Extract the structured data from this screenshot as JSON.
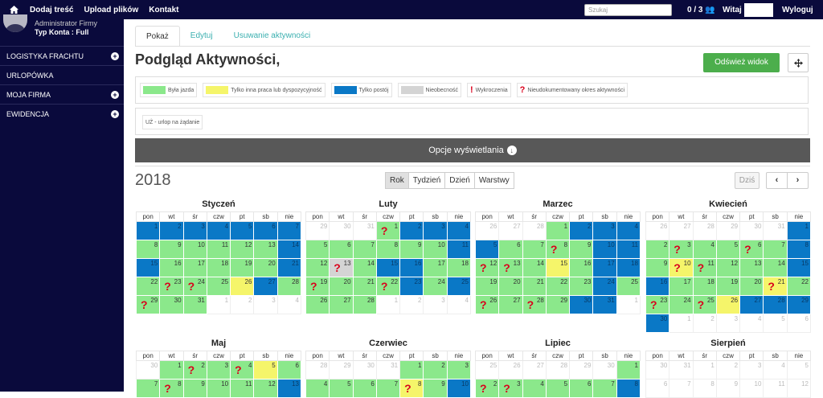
{
  "topbar": {
    "links": [
      "Dodaj treść",
      "Upload plików",
      "Kontakt"
    ],
    "search_placeholder": "Szukaj",
    "counter": "0 / 3",
    "greeting": "Witaj",
    "logout": "Wyloguj"
  },
  "sidebar": {
    "role": "Administrator Firmy",
    "account": "Typ Konta : Full",
    "items": [
      {
        "label": "LOGISTYKA FRACHTU",
        "expand": true
      },
      {
        "label": "URLOPÓWKA",
        "expand": false
      },
      {
        "label": "MOJA FIRMA",
        "expand": true
      },
      {
        "label": "EWIDENCJA",
        "expand": true
      }
    ]
  },
  "tabs": [
    "Pokaż",
    "Edytuj",
    "Usuwanie aktywności"
  ],
  "page_title": "Podgląd Aktywności,",
  "refresh_label": "Odśwież widok",
  "legend": [
    {
      "label": "Była jazda",
      "color": "#8be88b"
    },
    {
      "label": "Tylko inna praca lub dyspozycyjność",
      "color": "#f5f56a"
    },
    {
      "label": "Tylko postój",
      "color": "#0a78c6"
    },
    {
      "label": "Nieobecność",
      "color": "#d4d4d4"
    },
    {
      "label": "Wykroczenia",
      "icon": "!"
    },
    {
      "label": "Nieudokumentowany okres aktywności",
      "icon": "?"
    }
  ],
  "legend2": "UŻ - urlop na żądanie",
  "options_label": "Opcje wyświetlania",
  "year": "2018",
  "views": [
    "Rok",
    "Tydzień",
    "Dzień",
    "Warstwy"
  ],
  "today_label": "Dziś",
  "weekdays": [
    "pon",
    "wt",
    "śr",
    "czw",
    "pt",
    "sb",
    "nie"
  ],
  "months": [
    {
      "name": "Styczeń",
      "weeks": [
        [
          {
            "d": "1",
            "c": "b"
          },
          {
            "d": "2",
            "c": "b"
          },
          {
            "d": "3",
            "c": "b"
          },
          {
            "d": "4",
            "c": "b"
          },
          {
            "d": "5",
            "c": "b"
          },
          {
            "d": "6",
            "c": "b"
          },
          {
            "d": "7",
            "c": "b"
          }
        ],
        [
          {
            "d": "8",
            "c": "g"
          },
          {
            "d": "9",
            "c": "g"
          },
          {
            "d": "10",
            "c": "g"
          },
          {
            "d": "11",
            "c": "g"
          },
          {
            "d": "12",
            "c": "g"
          },
          {
            "d": "13",
            "c": "g"
          },
          {
            "d": "14",
            "c": "b"
          }
        ],
        [
          {
            "d": "15",
            "c": "b"
          },
          {
            "d": "16",
            "c": "g"
          },
          {
            "d": "17",
            "c": "g"
          },
          {
            "d": "18",
            "c": "g"
          },
          {
            "d": "19",
            "c": "g"
          },
          {
            "d": "20",
            "c": "g"
          },
          {
            "d": "21",
            "c": "b"
          }
        ],
        [
          {
            "d": "22",
            "c": "g"
          },
          {
            "d": "23",
            "c": "g",
            "q": "?"
          },
          {
            "d": "24",
            "c": "g",
            "q": "?"
          },
          {
            "d": "25",
            "c": "g"
          },
          {
            "d": "26",
            "c": "y"
          },
          {
            "d": "27",
            "c": "b"
          },
          {
            "d": "28",
            "c": "g"
          }
        ],
        [
          {
            "d": "29",
            "c": "g",
            "q": "?"
          },
          {
            "d": "30",
            "c": "g"
          },
          {
            "d": "31",
            "c": "g"
          },
          {
            "d": "1",
            "c": "o"
          },
          {
            "d": "2",
            "c": "o"
          },
          {
            "d": "3",
            "c": "o"
          },
          {
            "d": "4",
            "c": "o"
          }
        ]
      ]
    },
    {
      "name": "Luty",
      "weeks": [
        [
          {
            "d": "29",
            "c": "o"
          },
          {
            "d": "30",
            "c": "o"
          },
          {
            "d": "31",
            "c": "o"
          },
          {
            "d": "1",
            "c": "g",
            "q": "?"
          },
          {
            "d": "2",
            "c": "b"
          },
          {
            "d": "3",
            "c": "b"
          },
          {
            "d": "4",
            "c": "b"
          }
        ],
        [
          {
            "d": "5",
            "c": "g"
          },
          {
            "d": "6",
            "c": "g"
          },
          {
            "d": "7",
            "c": "g"
          },
          {
            "d": "8",
            "c": "g"
          },
          {
            "d": "9",
            "c": "g"
          },
          {
            "d": "10",
            "c": "g"
          },
          {
            "d": "11",
            "c": "b"
          }
        ],
        [
          {
            "d": "12",
            "c": "g"
          },
          {
            "d": "13",
            "c": "s",
            "q": "?"
          },
          {
            "d": "14",
            "c": "g"
          },
          {
            "d": "15",
            "c": "b"
          },
          {
            "d": "16",
            "c": "b"
          },
          {
            "d": "17",
            "c": "g"
          },
          {
            "d": "18",
            "c": "g"
          }
        ],
        [
          {
            "d": "19",
            "c": "g",
            "q": "?"
          },
          {
            "d": "20",
            "c": "g"
          },
          {
            "d": "21",
            "c": "g"
          },
          {
            "d": "22",
            "c": "g",
            "q": "?"
          },
          {
            "d": "23",
            "c": "b"
          },
          {
            "d": "24",
            "c": "g"
          },
          {
            "d": "25",
            "c": "b"
          }
        ],
        [
          {
            "d": "26",
            "c": "g"
          },
          {
            "d": "27",
            "c": "g"
          },
          {
            "d": "28",
            "c": "g"
          },
          {
            "d": "1",
            "c": "o"
          },
          {
            "d": "2",
            "c": "o"
          },
          {
            "d": "3",
            "c": "o"
          },
          {
            "d": "4",
            "c": "o"
          }
        ]
      ]
    },
    {
      "name": "Marzec",
      "weeks": [
        [
          {
            "d": "26",
            "c": "o"
          },
          {
            "d": "27",
            "c": "o"
          },
          {
            "d": "28",
            "c": "o"
          },
          {
            "d": "1",
            "c": "g"
          },
          {
            "d": "2",
            "c": "b"
          },
          {
            "d": "3",
            "c": "b"
          },
          {
            "d": "4",
            "c": "b"
          }
        ],
        [
          {
            "d": "5",
            "c": "b"
          },
          {
            "d": "6",
            "c": "g"
          },
          {
            "d": "7",
            "c": "g"
          },
          {
            "d": "8",
            "c": "g",
            "q": "?"
          },
          {
            "d": "9",
            "c": "g"
          },
          {
            "d": "10",
            "c": "b"
          },
          {
            "d": "11",
            "c": "b"
          }
        ],
        [
          {
            "d": "12",
            "c": "g",
            "q": "?"
          },
          {
            "d": "13",
            "c": "g",
            "q": "?"
          },
          {
            "d": "14",
            "c": "g"
          },
          {
            "d": "15",
            "c": "y"
          },
          {
            "d": "16",
            "c": "g"
          },
          {
            "d": "17",
            "c": "b"
          },
          {
            "d": "18",
            "c": "b"
          }
        ],
        [
          {
            "d": "19",
            "c": "g"
          },
          {
            "d": "20",
            "c": "g"
          },
          {
            "d": "21",
            "c": "g"
          },
          {
            "d": "22",
            "c": "g"
          },
          {
            "d": "23",
            "c": "g"
          },
          {
            "d": "24",
            "c": "b"
          },
          {
            "d": "25",
            "c": "g"
          }
        ],
        [
          {
            "d": "26",
            "c": "g",
            "q": "?"
          },
          {
            "d": "27",
            "c": "g"
          },
          {
            "d": "28",
            "c": "g",
            "q": "?"
          },
          {
            "d": "29",
            "c": "g"
          },
          {
            "d": "30",
            "c": "b"
          },
          {
            "d": "31",
            "c": "b"
          },
          {
            "d": "1",
            "c": "o"
          }
        ]
      ]
    },
    {
      "name": "Kwiecień",
      "weeks": [
        [
          {
            "d": "26",
            "c": "o"
          },
          {
            "d": "27",
            "c": "o"
          },
          {
            "d": "28",
            "c": "o"
          },
          {
            "d": "29",
            "c": "o"
          },
          {
            "d": "30",
            "c": "o"
          },
          {
            "d": "31",
            "c": "o"
          },
          {
            "d": "1",
            "c": "b"
          }
        ],
        [
          {
            "d": "2",
            "c": "g"
          },
          {
            "d": "3",
            "c": "g",
            "q": "?"
          },
          {
            "d": "4",
            "c": "g"
          },
          {
            "d": "5",
            "c": "g"
          },
          {
            "d": "6",
            "c": "g",
            "q": "?"
          },
          {
            "d": "7",
            "c": "g"
          },
          {
            "d": "8",
            "c": "b"
          }
        ],
        [
          {
            "d": "9",
            "c": "g"
          },
          {
            "d": "10",
            "c": "y",
            "q": "?"
          },
          {
            "d": "11",
            "c": "g",
            "q": "?"
          },
          {
            "d": "12",
            "c": "g"
          },
          {
            "d": "13",
            "c": "g"
          },
          {
            "d": "14",
            "c": "g"
          },
          {
            "d": "15",
            "c": "b"
          }
        ],
        [
          {
            "d": "16",
            "c": "b"
          },
          {
            "d": "17",
            "c": "g"
          },
          {
            "d": "18",
            "c": "g"
          },
          {
            "d": "19",
            "c": "g"
          },
          {
            "d": "20",
            "c": "g"
          },
          {
            "d": "21",
            "c": "y",
            "q": "?"
          },
          {
            "d": "22",
            "c": "g"
          }
        ],
        [
          {
            "d": "23",
            "c": "g",
            "q": "?"
          },
          {
            "d": "24",
            "c": "g"
          },
          {
            "d": "25",
            "c": "g",
            "q": "?"
          },
          {
            "d": "26",
            "c": "y"
          },
          {
            "d": "27",
            "c": "b"
          },
          {
            "d": "28",
            "c": "b"
          },
          {
            "d": "29",
            "c": "b"
          }
        ],
        [
          {
            "d": "30",
            "c": "b"
          },
          {
            "d": "1",
            "c": "o"
          },
          {
            "d": "2",
            "c": "o"
          },
          {
            "d": "3",
            "c": "o"
          },
          {
            "d": "4",
            "c": "o"
          },
          {
            "d": "5",
            "c": "o"
          },
          {
            "d": "6",
            "c": "o"
          }
        ]
      ]
    },
    {
      "name": "Maj",
      "weeks": [
        [
          {
            "d": "30",
            "c": "o"
          },
          {
            "d": "1",
            "c": "g"
          },
          {
            "d": "2",
            "c": "g",
            "q": "?"
          },
          {
            "d": "3",
            "c": "g"
          },
          {
            "d": "4",
            "c": "g",
            "q": "?"
          },
          {
            "d": "5",
            "c": "y"
          },
          {
            "d": "6",
            "c": "g"
          }
        ],
        [
          {
            "d": "7",
            "c": "g"
          },
          {
            "d": "8",
            "c": "g",
            "q": "?"
          },
          {
            "d": "9",
            "c": "g"
          },
          {
            "d": "10",
            "c": "g"
          },
          {
            "d": "11",
            "c": "g"
          },
          {
            "d": "12",
            "c": "g"
          },
          {
            "d": "13",
            "c": "b"
          }
        ]
      ]
    },
    {
      "name": "Czerwiec",
      "weeks": [
        [
          {
            "d": "28",
            "c": "o"
          },
          {
            "d": "29",
            "c": "o"
          },
          {
            "d": "30",
            "c": "o"
          },
          {
            "d": "31",
            "c": "o"
          },
          {
            "d": "1",
            "c": "g"
          },
          {
            "d": "2",
            "c": "g"
          },
          {
            "d": "3",
            "c": "g"
          }
        ],
        [
          {
            "d": "4",
            "c": "g"
          },
          {
            "d": "5",
            "c": "g"
          },
          {
            "d": "6",
            "c": "g"
          },
          {
            "d": "7",
            "c": "g"
          },
          {
            "d": "8",
            "c": "y",
            "q": "?"
          },
          {
            "d": "9",
            "c": "g"
          },
          {
            "d": "10",
            "c": "b"
          }
        ]
      ]
    },
    {
      "name": "Lipiec",
      "weeks": [
        [
          {
            "d": "25",
            "c": "o"
          },
          {
            "d": "26",
            "c": "o"
          },
          {
            "d": "27",
            "c": "o"
          },
          {
            "d": "28",
            "c": "o"
          },
          {
            "d": "29",
            "c": "o"
          },
          {
            "d": "30",
            "c": "o"
          },
          {
            "d": "1",
            "c": "g"
          }
        ],
        [
          {
            "d": "2",
            "c": "g",
            "q": "?"
          },
          {
            "d": "3",
            "c": "g",
            "q": "?"
          },
          {
            "d": "4",
            "c": "g"
          },
          {
            "d": "5",
            "c": "g"
          },
          {
            "d": "6",
            "c": "g"
          },
          {
            "d": "7",
            "c": "g"
          },
          {
            "d": "8",
            "c": "b"
          }
        ]
      ]
    },
    {
      "name": "Sierpień",
      "weeks": [
        [
          {
            "d": "30",
            "c": "o"
          },
          {
            "d": "31",
            "c": "o"
          },
          {
            "d": "1",
            "c": "o"
          },
          {
            "d": "2",
            "c": "o"
          },
          {
            "d": "3",
            "c": "o"
          },
          {
            "d": "4",
            "c": "o"
          },
          {
            "d": "5",
            "c": "o"
          }
        ],
        [
          {
            "d": "6",
            "c": "o"
          },
          {
            "d": "7",
            "c": "o"
          },
          {
            "d": "8",
            "c": "o"
          },
          {
            "d": "9",
            "c": "o"
          },
          {
            "d": "10",
            "c": "o"
          },
          {
            "d": "11",
            "c": "o"
          },
          {
            "d": "12",
            "c": "o"
          }
        ]
      ]
    }
  ]
}
